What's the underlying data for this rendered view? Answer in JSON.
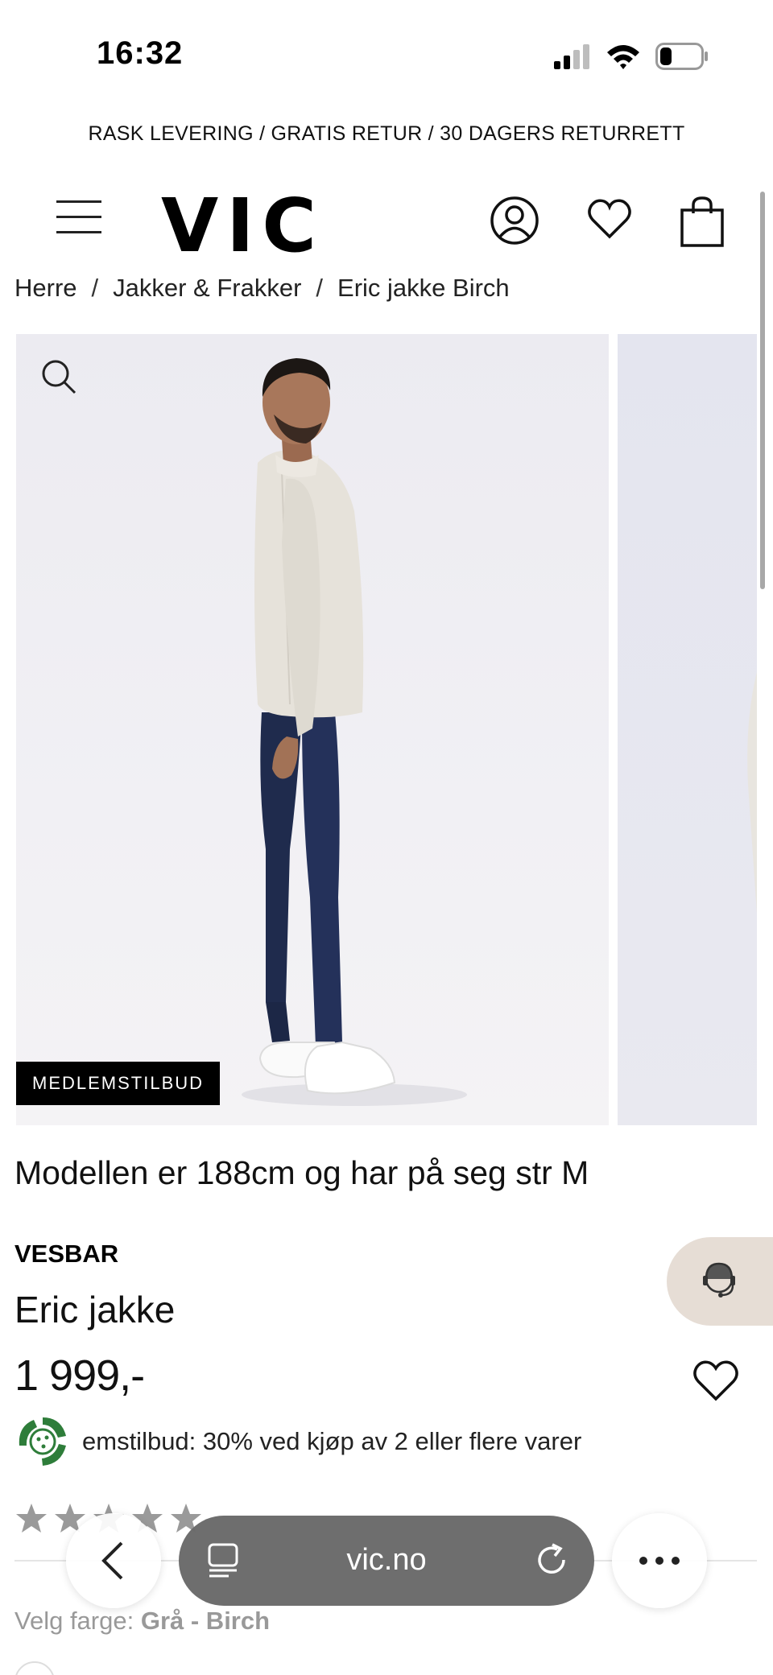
{
  "status_bar": {
    "time": "16:32",
    "signal_icon": "signal-bars-icon",
    "wifi_icon": "wifi-icon",
    "battery_icon": "battery-icon"
  },
  "promo_bar": {
    "text": "RASK LEVERING / GRATIS RETUR / 30 DAGERS RETURRETT"
  },
  "header": {
    "logo": "VIC",
    "icons": [
      "menu-icon",
      "account-icon",
      "heart-icon",
      "shopping-bag-icon"
    ]
  },
  "breadcrumb": {
    "items": [
      "Herre",
      "Jakker & Frakker",
      "Eric jakke Birch"
    ],
    "separator": "/"
  },
  "gallery": {
    "badge": "MEDLEMSTILBUD",
    "zoom_icon": "search-icon"
  },
  "product": {
    "model_info": "Modellen er 188cm og har på seg str M",
    "brand": "VESBAR",
    "name": "Eric jakke",
    "price": "1 999,-",
    "offer": "emstilbud: 30% ved kjøp av 2 eller flere varer",
    "offer_icon": "recycle-badge-icon",
    "rating_stars": 5,
    "color_label": "Velg farge:",
    "color_value": "Grå - Birch"
  },
  "browser": {
    "url": "vic.no",
    "back_icon": "chevron-left-icon",
    "tabs_icon": "tabs-icon",
    "reload_icon": "reload-icon",
    "more_icon": "more-icon"
  },
  "colors": {
    "badge_bg": "#000000",
    "chat_bg": "#e6ddd5",
    "url_bar_bg": "#696969",
    "offer_green": "#2e7d3a"
  }
}
